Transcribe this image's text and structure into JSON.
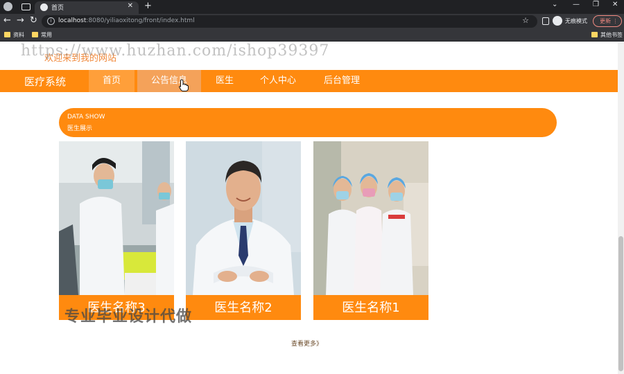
{
  "browser": {
    "tab_title": "首页",
    "url_host": "localhost",
    "url_rest": ":8080/yiliaoxitong/front/index.html",
    "incognito_label": "无痕模式",
    "update_label": "更新",
    "bookmarks": [
      "资料",
      "常用"
    ],
    "other_bookmarks": "其他书签"
  },
  "page": {
    "welcome": "欢迎来到我的网站",
    "watermark_top": "https://www.huzhan.com/ishop39397",
    "watermark_bottom": "专业毕业设计代做",
    "brand": "医疗系统",
    "nav": [
      "首页",
      "公告信息",
      "医生",
      "个人中心",
      "后台管理"
    ],
    "section_en": "DATA SHOW",
    "section_cn": "医生展示",
    "doctors": [
      {
        "name": "医生名称3"
      },
      {
        "name": "医生名称2"
      },
      {
        "name": "医生名称1"
      }
    ],
    "more": "查看更多》"
  },
  "colors": {
    "accent": "#ff8a0f",
    "welcome_text": "#f0883a"
  }
}
